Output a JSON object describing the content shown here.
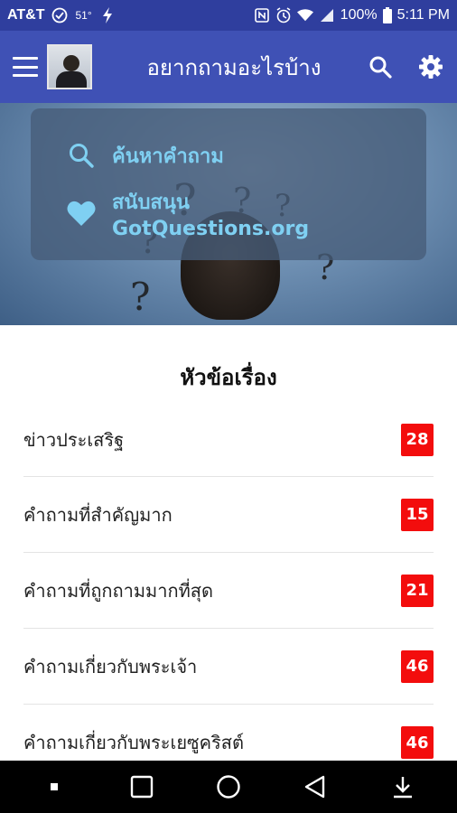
{
  "status_bar": {
    "carrier": "AT&T",
    "temperature": "51°",
    "battery": "100%",
    "time": "5:11 PM",
    "icons": [
      "check-circle-icon",
      "lightning-icon",
      "nfc-icon",
      "alarm-icon",
      "wifi-icon",
      "signal-icon",
      "battery-icon"
    ]
  },
  "app_bar": {
    "title": "อยากถามอะไรบ้าง",
    "icons": [
      "menu-icon",
      "search-icon",
      "settings-icon"
    ]
  },
  "hero_menu": {
    "items": [
      {
        "label": "ค้นหาคำถาม",
        "icon": "search-icon"
      },
      {
        "label": "สนับสนุน GotQuestions.org",
        "icon": "heart-icon"
      }
    ]
  },
  "topics": {
    "title": "หัวข้อเรื่อง",
    "items": [
      {
        "label": "ข่าวประเสริฐ",
        "count": "28"
      },
      {
        "label": "คำถามที่สำคัญมาก",
        "count": "15"
      },
      {
        "label": "คำถามที่ถูกถามมากที่สุด",
        "count": "21"
      },
      {
        "label": "คำถามเกี่ยวกับพระเจ้า",
        "count": "46"
      },
      {
        "label": "คำถามเกี่ยวกับพระเยซูคริสต์",
        "count": "46"
      }
    ]
  },
  "colors": {
    "status_bar": "#2f3e9e",
    "app_bar": "#3f51b5",
    "hero_text": "#7fd0f2",
    "badge": "#f30d0d"
  }
}
